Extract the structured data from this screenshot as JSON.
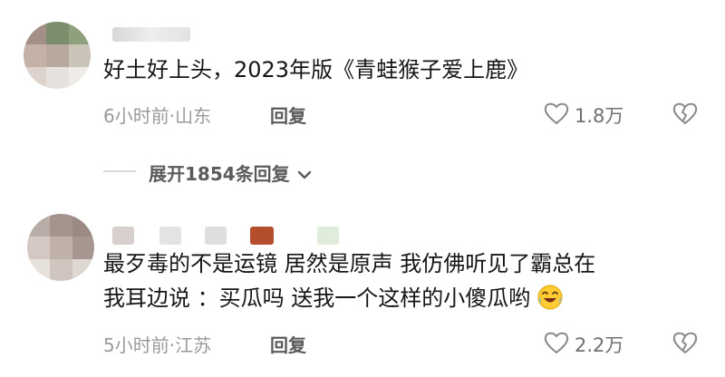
{
  "comments": [
    {
      "text_lines": [
        "好土好上头，2023年版《青蛙猴子爱上鹿》"
      ],
      "time": "6小时前",
      "location": "山东",
      "reply_label": "回复",
      "likes": "1.8万"
    },
    {
      "text_lines": [
        "最歹毒的不是运镜 居然是原声 我仿佛听见了霸总在",
        "我耳边说 ：买瓜吗 送我一个这样的小傻瓜哟"
      ],
      "time": "5小时前",
      "location": "江苏",
      "reply_label": "回复",
      "likes": "2.2万"
    }
  ],
  "expand": {
    "label": "展开1854条回复"
  },
  "colors": {
    "text": "#161616",
    "meta": "#9a9a9a",
    "reply": "#5b5b5b"
  },
  "icons": [
    "heart-icon",
    "broken-heart-icon",
    "chevron-down-icon",
    "laughing-emoji-icon"
  ]
}
